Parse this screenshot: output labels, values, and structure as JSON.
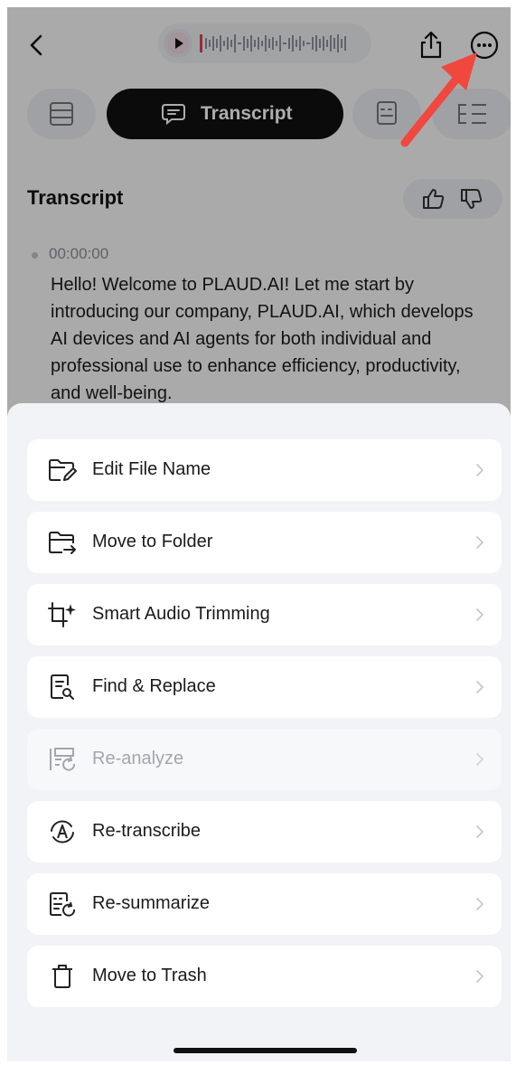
{
  "header": {
    "back_icon": "chevron-left-icon",
    "play_icon": "play-icon",
    "waveform_icon": "waveform-icon",
    "share_icon": "share-icon",
    "more_icon": "more-circle-icon"
  },
  "tabs": [
    {
      "id": "list",
      "icon": "list-icon",
      "label": ""
    },
    {
      "id": "transcript",
      "icon": "chat-bubble-icon",
      "label": "Transcript",
      "active": true
    },
    {
      "id": "summary",
      "icon": "summary-icon",
      "label": ""
    },
    {
      "id": "mindmap",
      "icon": "mindmap-icon",
      "label": ""
    }
  ],
  "transcript": {
    "title": "Transcript",
    "timestamp": "00:00:00",
    "text": "Hello! Welcome to PLAUD.AI! Let me start by introducing our company, PLAUD.AI, which develops AI devices and AI agents for both individual and professional use to enhance efficiency, productivity, and well-being."
  },
  "menu": {
    "items": [
      {
        "label": "Edit File Name",
        "icon": "folder-edit-icon",
        "enabled": true
      },
      {
        "label": "Move to Folder",
        "icon": "folder-move-icon",
        "enabled": true
      },
      {
        "label": "Smart Audio Trimming",
        "icon": "smart-trim-icon",
        "enabled": true
      },
      {
        "label": "Find & Replace",
        "icon": "find-replace-icon",
        "enabled": true
      },
      {
        "label": "Re-analyze",
        "icon": "reanalyze-icon",
        "enabled": false
      },
      {
        "label": "Re-transcribe",
        "icon": "retranscribe-icon",
        "enabled": true
      },
      {
        "label": "Re-summarize",
        "icon": "resummarize-icon",
        "enabled": true
      },
      {
        "label": "Move to Trash",
        "icon": "trash-icon",
        "enabled": true
      }
    ]
  },
  "colors": {
    "active_tab": "#111111",
    "arrow": "#f0483e",
    "sheet_bg": "#f2f3f6",
    "disabled_text": "#a3a6ad"
  }
}
